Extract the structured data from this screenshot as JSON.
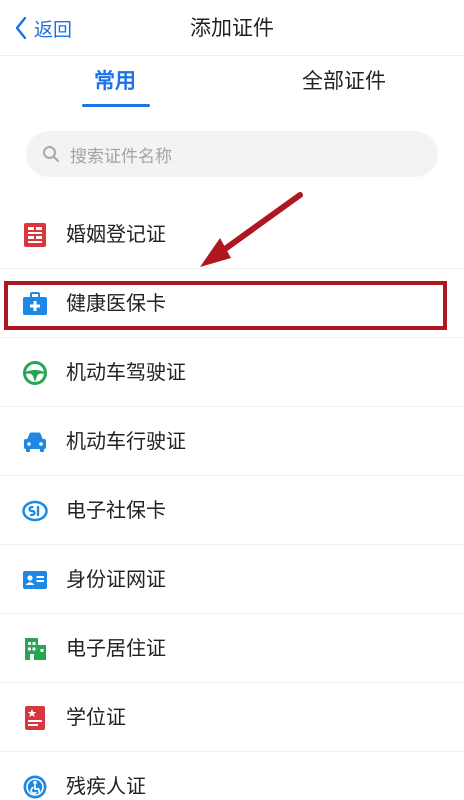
{
  "navbar": {
    "back_label": "返回",
    "title": "添加证件"
  },
  "tabs": [
    {
      "label": "常用",
      "active": true
    },
    {
      "label": "全部证件",
      "active": false
    }
  ],
  "search": {
    "placeholder": "搜索证件名称",
    "icon": "search-icon"
  },
  "items": [
    {
      "label": "婚姻登记证",
      "icon": "marriage-certificate-icon",
      "color": "#d9363e"
    },
    {
      "label": "健康医保卡",
      "icon": "medical-kit-icon",
      "color": "#1e88e5",
      "highlighted": true
    },
    {
      "label": "机动车驾驶证",
      "icon": "steering-wheel-icon",
      "color": "#26a653"
    },
    {
      "label": "机动车行驶证",
      "icon": "car-icon",
      "color": "#1e88e5"
    },
    {
      "label": "电子社保卡",
      "icon": "social-security-icon",
      "color": "#1e88e5"
    },
    {
      "label": "身份证网证",
      "icon": "id-card-icon",
      "color": "#1e88e5"
    },
    {
      "label": "电子居住证",
      "icon": "building-icon",
      "color": "#26a653"
    },
    {
      "label": "学位证",
      "icon": "degree-certificate-icon",
      "color": "#d9363e"
    },
    {
      "label": "残疾人证",
      "icon": "disability-certificate-icon",
      "color": "#1e88e5"
    }
  ],
  "colors": {
    "accent": "#1a73e8",
    "highlight": "#b0161f"
  }
}
